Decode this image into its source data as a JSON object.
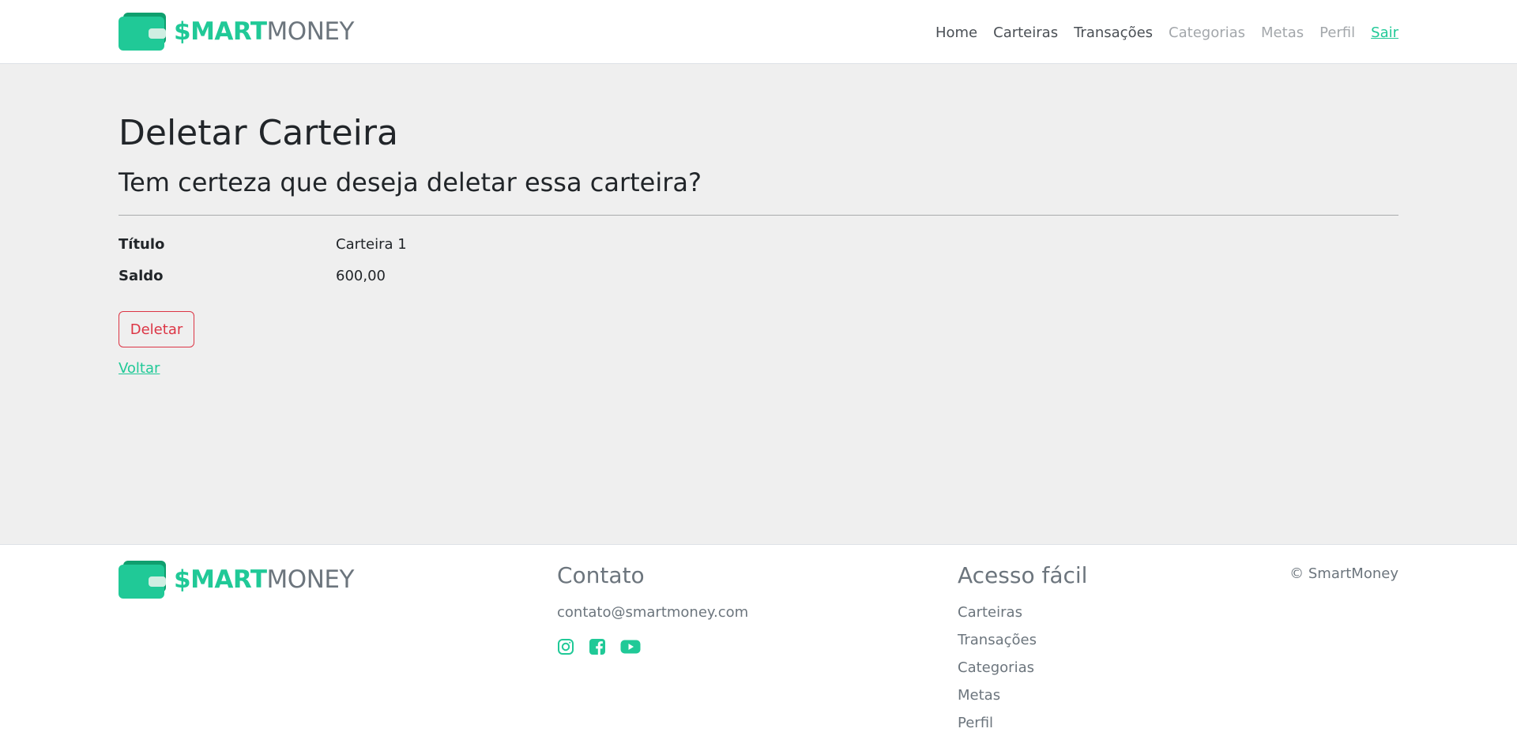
{
  "brand": {
    "smart": "$MART",
    "money": "MONEY",
    "icon": "wallet-icon",
    "accent": "#20c997"
  },
  "nav": {
    "items": [
      {
        "label": "Home"
      },
      {
        "label": "Carteiras"
      },
      {
        "label": "Transações"
      },
      {
        "label": "Categorias"
      },
      {
        "label": "Metas"
      },
      {
        "label": "Perfil"
      },
      {
        "label": "Sair"
      }
    ]
  },
  "page": {
    "title": "Deletar Carteira",
    "subtitle": "Tem certeza que deseja deletar essa carteira?",
    "fields": [
      {
        "label": "Título",
        "value": "Carteira 1"
      },
      {
        "label": "Saldo",
        "value": "600,00"
      }
    ],
    "delete_label": "Deletar",
    "back_label": "Voltar",
    "danger_color": "#dc3545"
  },
  "footer": {
    "contact": {
      "heading": "Contato",
      "email": "contato@smartmoney.com",
      "social": [
        "instagram-icon",
        "facebook-icon",
        "youtube-icon"
      ]
    },
    "access": {
      "heading": "Acesso fácil",
      "links": [
        "Carteiras",
        "Transações",
        "Categorias",
        "Metas",
        "Perfil"
      ]
    },
    "copyright": "© SmartMoney"
  }
}
